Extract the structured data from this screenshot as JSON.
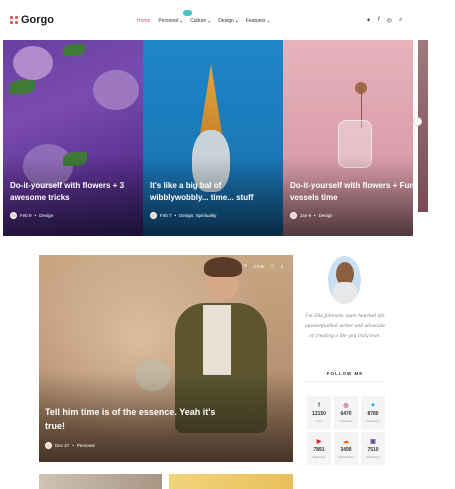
{
  "brand": {
    "name": "Gorgo",
    "accent": "#e05a5a"
  },
  "nav": [
    {
      "label": "Home",
      "active": true,
      "dropdown": false
    },
    {
      "label": "Personal",
      "active": false,
      "dropdown": true
    },
    {
      "label": "Culture",
      "active": false,
      "dropdown": true
    },
    {
      "label": "Design",
      "active": false,
      "dropdown": true
    },
    {
      "label": "Features",
      "active": false,
      "dropdown": true
    }
  ],
  "header_icons": [
    "twitter-icon",
    "facebook-icon",
    "instagram-icon",
    "search-icon"
  ],
  "slides": [
    {
      "title": "Do-it-yourself with flowers + 3 awesome tricks",
      "date": "Feb 9",
      "category": "Design"
    },
    {
      "title": "It's like a big bal of wibblywobbly... time... stuff",
      "date": "Feb 7",
      "category": "Design, Spirituality"
    },
    {
      "title": "Do-it-yourself with flowers + Fun vessels time",
      "date": "Jan 9",
      "category": "Design"
    }
  ],
  "feature": {
    "title": "Tell him time is of the essence. Yeah it's true!",
    "date": "Dec 27",
    "category": "Personal",
    "views": "2 min",
    "comments": "2"
  },
  "sidebar": {
    "bio": "I'm Ella Johnson; open-hearted life passionfuelled writer and advocate of creating a life you truly love.",
    "follow_label": "FOLLOW ME",
    "socials": [
      {
        "icon": "facebook-icon",
        "glyph": "f",
        "color": "#3b5998",
        "count": "12150",
        "label": "Likes"
      },
      {
        "icon": "instagram-icon",
        "glyph": "◎",
        "color": "#c13584",
        "count": "6470",
        "label": "Followers"
      },
      {
        "icon": "twitter-icon",
        "glyph": "✦",
        "color": "#1da1f2",
        "count": "8780",
        "label": "Followers"
      },
      {
        "icon": "youtube-icon",
        "glyph": "▶",
        "color": "#e62117",
        "count": "7891",
        "label": "Followers"
      },
      {
        "icon": "soundcloud-icon",
        "glyph": "☁",
        "color": "#ff5500",
        "count": "3490",
        "label": "Subscribers"
      },
      {
        "icon": "twitch-icon",
        "glyph": "▣",
        "color": "#6441a5",
        "count": "7510",
        "label": "Followers"
      }
    ]
  }
}
